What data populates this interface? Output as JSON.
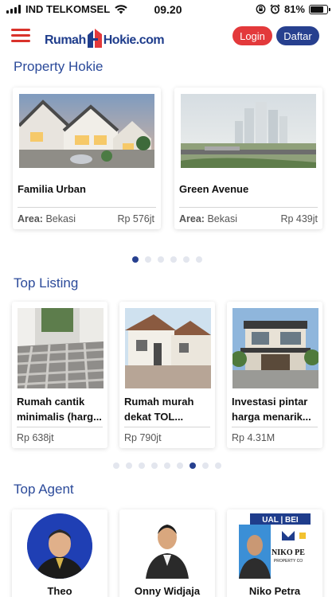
{
  "status_bar": {
    "carrier": "IND TELKOMSEL",
    "time": "09.20",
    "battery": "81%",
    "battery_level": 0.81,
    "icons": [
      "signal-icon",
      "wifi-icon",
      "rotation-lock-icon",
      "alarm-icon",
      "battery-icon"
    ]
  },
  "header": {
    "logo_part1": "Rumah",
    "logo_part2": "Hokie.com",
    "login_label": "Login",
    "register_label": "Daftar",
    "colors": {
      "red": "#e3393b",
      "navy": "#27408f"
    }
  },
  "property_section": {
    "title": "Property Hokie",
    "cards": [
      {
        "name": "Familia Urban",
        "area_label": "Area:",
        "area": "Bekasi",
        "price": "Rp 576jt"
      },
      {
        "name": "Green Avenue",
        "area_label": "Area:",
        "area": "Bekasi",
        "price": "Rp 439jt"
      }
    ],
    "dot_count": 6,
    "active_dot": 0
  },
  "listing_section": {
    "title": "Top Listing",
    "cards": [
      {
        "title_line1": "Rumah cantik",
        "title_line2": "minimalis (harg...",
        "price": "Rp 638jt"
      },
      {
        "title_line1": "Rumah murah",
        "title_line2": "dekat TOL...",
        "price": "Rp 790jt"
      },
      {
        "title_line1": "Investasi pintar",
        "title_line2": "harga menarik...",
        "price": "Rp 4.31M"
      }
    ],
    "dot_count": 9,
    "active_dot": 6
  },
  "agent_section": {
    "title": "Top Agent",
    "agents": [
      {
        "name": "Theo"
      },
      {
        "name": "Onny Widjaja"
      },
      {
        "name": "Niko Petra",
        "banner_text": "NIKO PE",
        "banner_sub": "PROPERTY CO",
        "banner_top": "UAL | BEI"
      }
    ]
  }
}
